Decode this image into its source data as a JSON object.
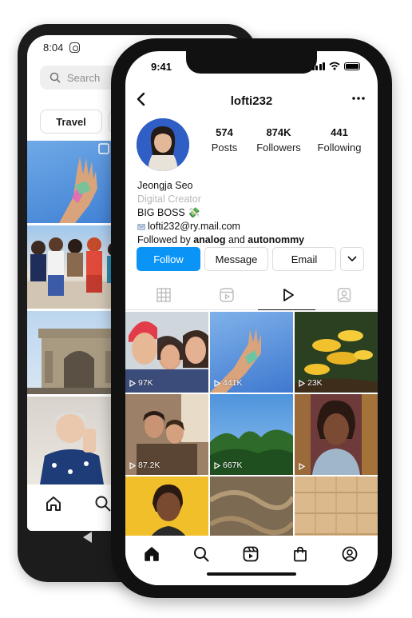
{
  "back_phone": {
    "time": "8:04",
    "search_placeholder": "Search",
    "chip": "Travel"
  },
  "status_bar": {
    "time": "9:41"
  },
  "profile": {
    "username": "lofti232",
    "stats": [
      {
        "count": "574",
        "label": "Posts"
      },
      {
        "count": "874K",
        "label": "Followers"
      },
      {
        "count": "441",
        "label": "Following"
      }
    ],
    "full_name": "Jeongja Seo",
    "category": "Digital Creator",
    "bio_line": "BIG BOSS 💸",
    "email_line": "lofti232@ry.mail.com",
    "followed_by_prefix": "Followed by ",
    "followed_by_user1": "analog",
    "followed_by_and": " and ",
    "followed_by_user2": "autonommy"
  },
  "actions": {
    "follow": "Follow",
    "message": "Message",
    "email": "Email"
  },
  "reels": [
    {
      "views": "97K"
    },
    {
      "views": "441K"
    },
    {
      "views": "23K"
    },
    {
      "views": "87.2K"
    },
    {
      "views": "667K"
    },
    {
      "views": ""
    }
  ],
  "colors": {
    "follow_blue": "#0a95f6",
    "text": "#111111",
    "category_gray": "#b8b8b8"
  },
  "icons": {
    "tabs": [
      "grid-icon",
      "reels-tab-icon",
      "play-icon",
      "tagged-icon"
    ],
    "bottom_nav": [
      "home-icon",
      "search-icon",
      "reels-icon",
      "shop-icon",
      "profile-icon"
    ]
  }
}
